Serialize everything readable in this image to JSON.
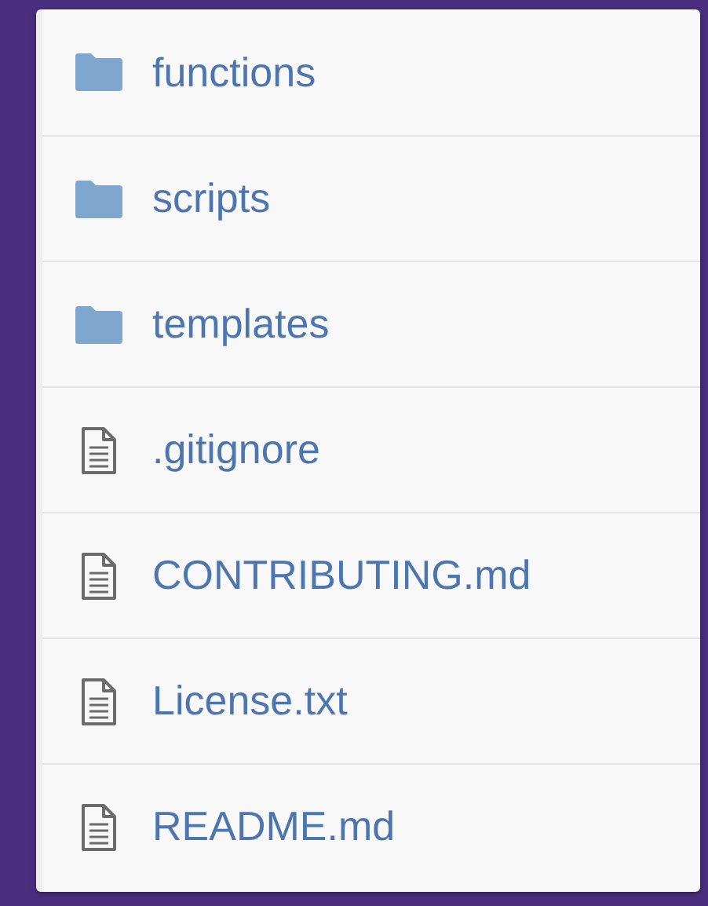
{
  "files": [
    {
      "kind": "folder",
      "name": "functions"
    },
    {
      "kind": "folder",
      "name": "scripts"
    },
    {
      "kind": "folder",
      "name": "templates"
    },
    {
      "kind": "file",
      "name": ".gitignore"
    },
    {
      "kind": "file",
      "name": "CONTRIBUTING.md"
    },
    {
      "kind": "file",
      "name": "License.txt"
    },
    {
      "kind": "file",
      "name": "README.md"
    }
  ]
}
